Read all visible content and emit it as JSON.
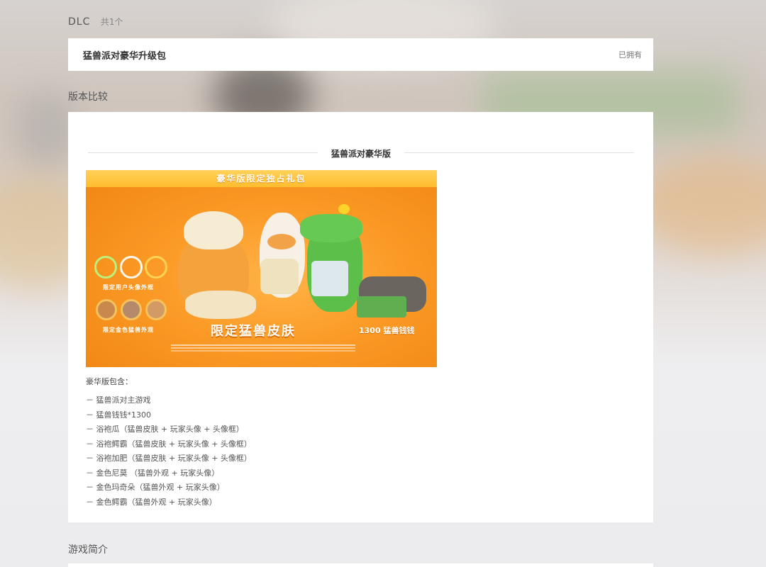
{
  "dlc": {
    "title": "DLC",
    "count": "共1个",
    "item_name": "猛兽派对豪华升级包",
    "item_status": "已拥有"
  },
  "compare": {
    "title": "版本比较",
    "edition_name": "猛兽派对豪华版",
    "promo": {
      "banner": "豪华版限定独占礼包",
      "frames_caption": "限定用户头像外框",
      "gold_caption": "限定金色猛兽外观",
      "skins_caption": "限定猛兽皮肤",
      "coins_caption": "1300 猛兽钱钱"
    },
    "includes_label": "豪华版包含：",
    "items": [
      "－ 猛兽派对主游戏",
      "－ 猛兽钱钱*1300",
      "－ 浴袍瓜（猛兽皮肤 + 玩家头像 + 头像框）",
      "－ 浴袍鳄霸（猛兽皮肤 + 玩家头像 + 头像框）",
      "－ 浴袍加肥（猛兽皮肤 + 玩家头像 + 头像框）",
      "－ 金色尼莫 （猛兽外观 + 玩家头像）",
      "－ 金色玛奇朵（猛兽外观 + 玩家头像）",
      "－ 金色鳄霸（猛兽外观 + 玩家头像）"
    ]
  },
  "intro": {
    "title": "游戏简介"
  }
}
